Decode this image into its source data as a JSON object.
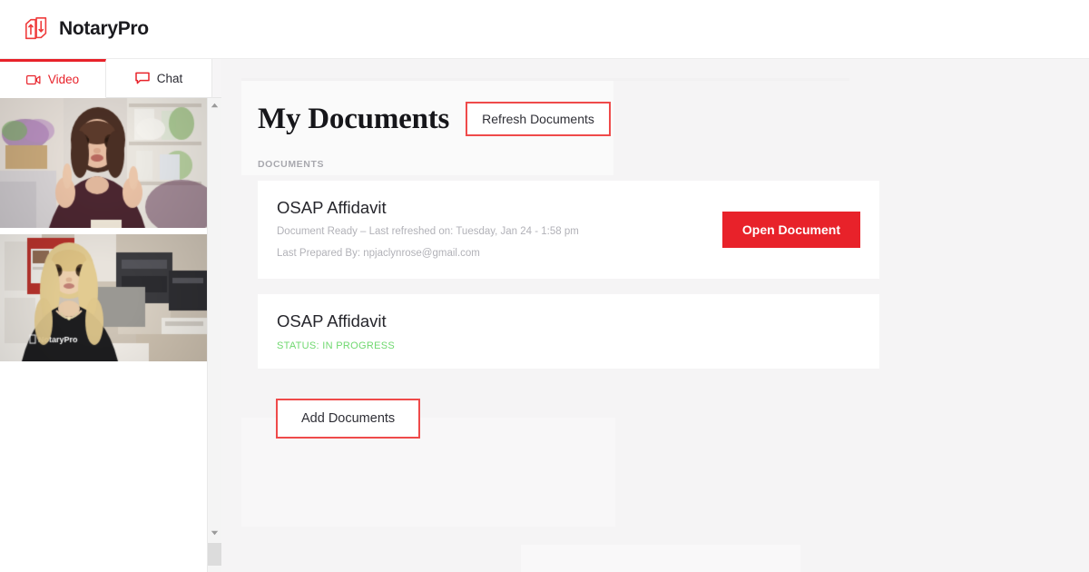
{
  "brand": {
    "name": "NotaryPro",
    "logo_icon": "notarypro-documents-logo",
    "accent_color": "#e8222a"
  },
  "left_panel": {
    "tabs": [
      {
        "label": "Video",
        "icon": "video-camera-icon",
        "active": true
      },
      {
        "label": "Chat",
        "icon": "chat-bubble-icon",
        "active": false
      }
    ],
    "video_tiles": [
      {
        "participant": "client-video-tile",
        "description": "Woman with long brown hair gesturing in a living room with plant and shelves"
      },
      {
        "participant": "notary-video-tile",
        "description": "Blonde woman wearing a black NotaryPro t-shirt in an office with a printer"
      }
    ],
    "scrollbar": {
      "up_arrow_icon": "scroll-up-arrow-icon",
      "down_arrow_icon": "scroll-down-arrow-icon"
    }
  },
  "main": {
    "title": "My Documents",
    "refresh_label": "Refresh Documents",
    "section_label": "DOCUMENTS",
    "add_label": "Add Documents",
    "documents": [
      {
        "title": "OSAP Affidavit",
        "meta_line_1": "Document Ready – Last refreshed on: Tuesday, Jan 24 - 1:58 pm",
        "meta_line_2": "Last Prepared By: npjaclynrose@gmail.com",
        "action_label": "Open Document"
      },
      {
        "title": "OSAP Affidavit",
        "status": "STATUS: IN PROGRESS",
        "status_color": "#6fd86f"
      }
    ]
  }
}
